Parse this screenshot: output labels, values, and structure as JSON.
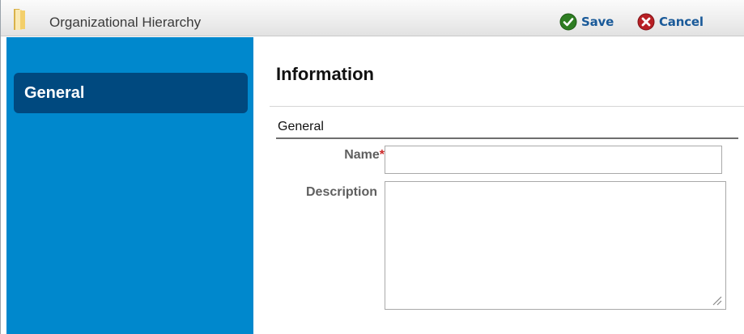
{
  "window": {
    "title": "Organizational Hierarchy",
    "icon": "folder-icon"
  },
  "toolbar": {
    "save_label": "Save",
    "save_icon": "check-circle-icon",
    "cancel_label": "Cancel",
    "cancel_icon": "x-circle-icon"
  },
  "sidebar": {
    "items": [
      {
        "label": "General",
        "selected": true
      }
    ]
  },
  "main": {
    "section_title": "Information",
    "group_title": "General",
    "fields": {
      "name": {
        "label": "Name",
        "required_marker": "*",
        "value": ""
      },
      "description": {
        "label": "Description",
        "value": ""
      }
    }
  },
  "colors": {
    "sidebar_bg": "#0088cd",
    "nav_selected_bg": "#00497f",
    "action_text": "#1a5a99",
    "save_green": "#2e7d22",
    "cancel_red": "#b81f24",
    "required": "#cc2a2a"
  }
}
